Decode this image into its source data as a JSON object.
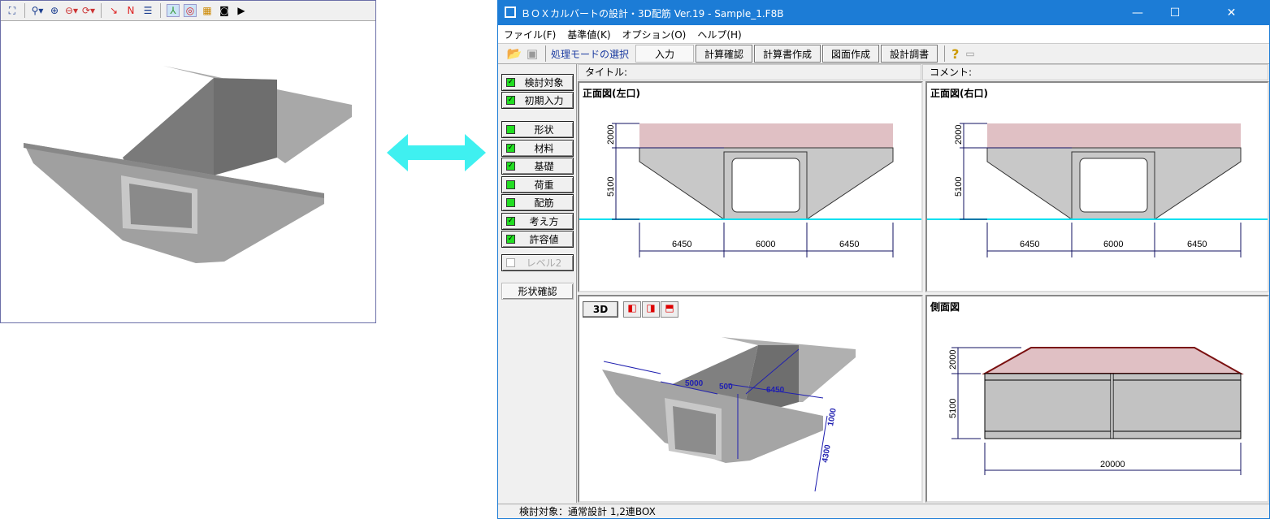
{
  "viewer": {
    "toolbar_icons": [
      "fit-view-icon",
      "binoculars-icon",
      "zoom-in-binoculars-icon",
      "zoom-out-binoculars-icon",
      "rotate-view-icon",
      "axis-point-icon",
      "edge-icon",
      "align-icon",
      "axis-toggle-icon",
      "target-icon",
      "palette-icon",
      "camera-icon",
      "video-icon"
    ]
  },
  "window": {
    "title": "ＢＯＸカルバートの設計・3D配筋 Ver.19 - Sample_1.F8B",
    "min": "—",
    "max": "☐",
    "close": "✕"
  },
  "menu": [
    "ファイル(F)",
    "基準値(K)",
    "オプション(O)",
    "ヘルプ(H)"
  ],
  "toolbar": {
    "mode_label": "処理モードの選択",
    "modes": [
      "入力",
      "計算確認",
      "計算書作成",
      "図面作成",
      "設計調書"
    ]
  },
  "nav": {
    "top": [
      "検討対象",
      "初期入力"
    ],
    "items": [
      "形状",
      "材料",
      "基礎",
      "荷重",
      "配筋",
      "考え方",
      "許容値"
    ],
    "checked": [
      false,
      true,
      true,
      false,
      false,
      true,
      true
    ],
    "level2": "レベル2",
    "shape_check": "形状確認"
  },
  "header": {
    "title_label": "タイトル:",
    "comment_label": "コメント:"
  },
  "front_left": {
    "title": "正面図(左口)",
    "dims_v": [
      "2000",
      "5100"
    ],
    "dims_h": [
      "6450",
      "6000",
      "6450"
    ]
  },
  "front_right": {
    "title": "正面図(右口)",
    "dims_v": [
      "2000",
      "5100"
    ],
    "dims_h": [
      "6450",
      "6000",
      "6450"
    ]
  },
  "view3d": {
    "button": "3D",
    "labels": [
      "5000",
      "500",
      "6450",
      "1000",
      "4300"
    ]
  },
  "side": {
    "title": "側面図",
    "dims_v": [
      "2000",
      "5100"
    ],
    "dim_h": "20000"
  },
  "status": "検討対象：通常設計 1,2連BOX",
  "colors": {
    "accent": "#1c7cd6",
    "cover": "#e0c0c4",
    "concrete": "#c8c8c8",
    "water": "#00e0f0",
    "arrow": "#3ff0f0"
  }
}
